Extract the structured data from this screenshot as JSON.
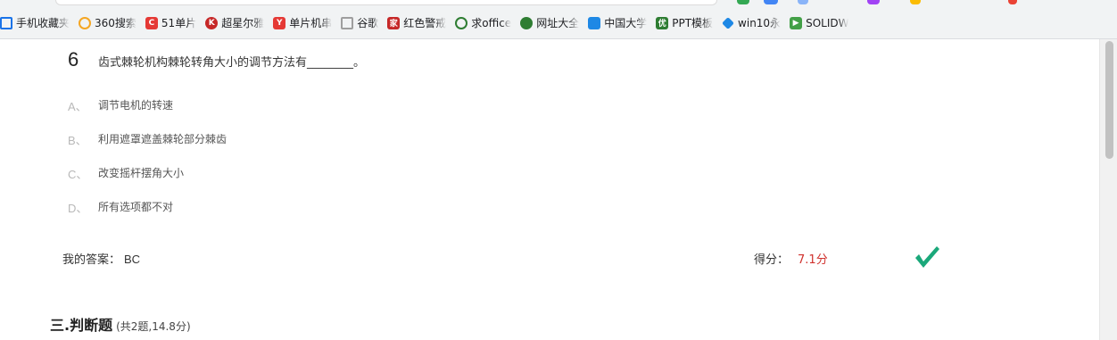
{
  "bookmarks": [
    {
      "label": "手机收藏夹",
      "icon": "phone-bookmark-icon",
      "color": "#1a73e8"
    },
    {
      "label": "360搜索",
      "icon": "360-search-icon",
      "color": "#f5a623"
    },
    {
      "label": "51单片",
      "icon": "c-logo-icon",
      "color": "#e53935"
    },
    {
      "label": "超星尔雅",
      "icon": "chaoxing-icon",
      "color": "#c62828"
    },
    {
      "label": "单片机串",
      "icon": "y-logo-icon",
      "color": "#e53935"
    },
    {
      "label": "谷歌",
      "icon": "page-icon",
      "color": "#9e9e9e"
    },
    {
      "label": "红色警戒",
      "icon": "home-logo-icon",
      "color": "#c62828"
    },
    {
      "label": "求office",
      "icon": "360-search-icon",
      "color": "#2e7d32"
    },
    {
      "label": "网址大全",
      "icon": "globe-icon",
      "color": "#2e7d32"
    },
    {
      "label": "中国大学",
      "icon": "book-icon",
      "color": "#1e88e5"
    },
    {
      "label": "PPT模板",
      "icon": "you-logo-icon",
      "color": "#2e7d32"
    },
    {
      "label": "win10永",
      "icon": "diamond-icon",
      "color": "#1e88e5"
    },
    {
      "label": "SOLIDW",
      "icon": "play-icon",
      "color": "#43a047"
    }
  ],
  "question": {
    "number": "6",
    "text": "齿式棘轮机构棘轮转角大小的调节方法有________。",
    "options": [
      {
        "letter": "A、",
        "text": "调节电机的转速"
      },
      {
        "letter": "B、",
        "text": "利用遮罩遮盖棘轮部分棘齿"
      },
      {
        "letter": "C、",
        "text": "改变摇杆摆角大小"
      },
      {
        "letter": "D、",
        "text": "所有选项都不对"
      }
    ],
    "answer_label": "我的答案：",
    "answer_value": "BC",
    "score_label": "得分：",
    "score_value": "7.1分",
    "correct": true
  },
  "section": {
    "title": "三.判断题",
    "subtitle": "(共2题,14.8分)"
  },
  "colors": {
    "check": "#1aa87a",
    "score": "#d0312d"
  }
}
